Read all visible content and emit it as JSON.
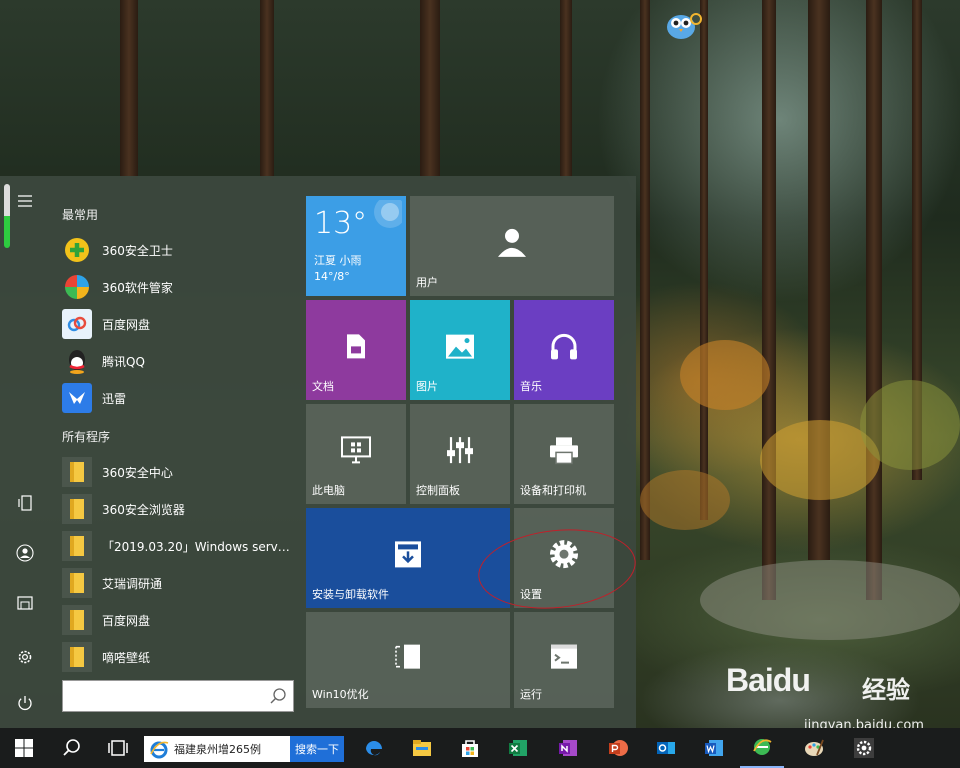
{
  "start_menu": {
    "section_frequent": "最常用",
    "frequent_apps": [
      {
        "label": "360安全卫士",
        "icon": "360-safe-icon"
      },
      {
        "label": "360软件管家",
        "icon": "360-software-manager-icon"
      },
      {
        "label": "百度网盘",
        "icon": "baidu-netdisk-icon"
      },
      {
        "label": "腾讯QQ",
        "icon": "qq-icon"
      },
      {
        "label": "迅雷",
        "icon": "xunlei-icon"
      }
    ],
    "section_all": "所有程序",
    "all_apps": [
      {
        "label": "360安全中心"
      },
      {
        "label": "360安全浏览器"
      },
      {
        "label": "「2019.03.20」Windows server..."
      },
      {
        "label": "艾瑞调研通"
      },
      {
        "label": "百度网盘"
      },
      {
        "label": "嘀嗒壁纸"
      }
    ],
    "search_placeholder": ""
  },
  "tiles": {
    "weather": {
      "temp": "13°",
      "location": "江夏 小雨",
      "range": "14°/8°"
    },
    "user": "用户",
    "documents": "文档",
    "pictures": "图片",
    "music": "音乐",
    "this_pc": "此电脑",
    "control_panel": "控制面板",
    "devices_printers": "设备和打印机",
    "install_uninstall": "安装与卸载软件",
    "settings": "设置",
    "win10_optimize": "Win10优化",
    "run": "运行"
  },
  "taskbar": {
    "search_query": "福建泉州增265例",
    "search_button": "搜索一下"
  },
  "watermark": {
    "logo": "Baidu",
    "cn": "经验",
    "url": "jingyan.baidu.com"
  },
  "colors": {
    "weather_tile": "#3c9ee6",
    "documents_tile": "#8e3a9e",
    "pictures_tile": "#1fb2c9",
    "music_tile": "#6b3ec2",
    "install_tile": "#1a4e9c",
    "annotation": "#c0202a"
  }
}
